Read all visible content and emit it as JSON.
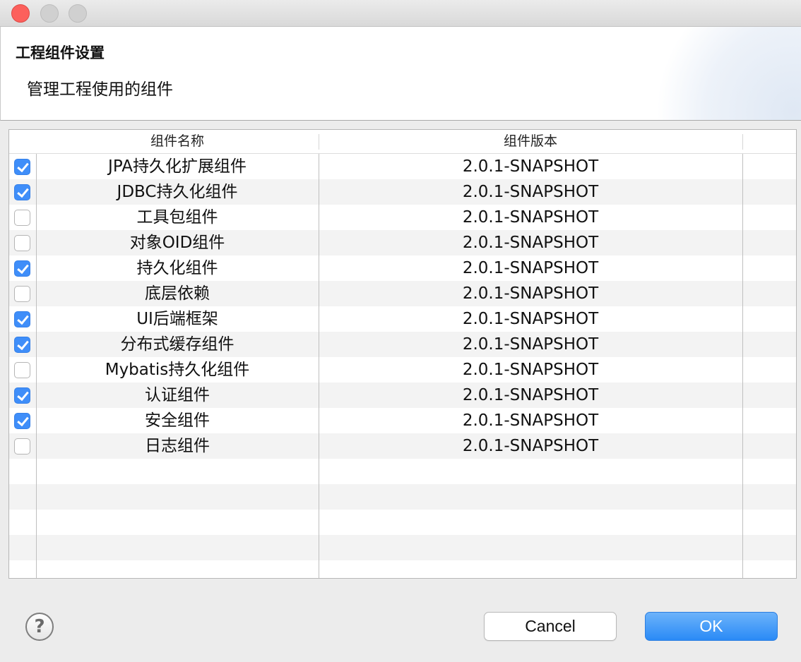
{
  "window": {
    "header_title": "工程组件设置",
    "header_description": "管理工程使用的组件"
  },
  "table": {
    "columns": [
      "组件名称",
      "组件版本"
    ],
    "rows": [
      {
        "checked": true,
        "name": "JPA持久化扩展组件",
        "version": "2.0.1-SNAPSHOT"
      },
      {
        "checked": true,
        "name": "JDBC持久化组件",
        "version": "2.0.1-SNAPSHOT"
      },
      {
        "checked": false,
        "name": "工具包组件",
        "version": "2.0.1-SNAPSHOT"
      },
      {
        "checked": false,
        "name": "对象OID组件",
        "version": "2.0.1-SNAPSHOT"
      },
      {
        "checked": true,
        "name": "持久化组件",
        "version": "2.0.1-SNAPSHOT"
      },
      {
        "checked": false,
        "name": "底层依赖",
        "version": "2.0.1-SNAPSHOT"
      },
      {
        "checked": true,
        "name": "UI后端框架",
        "version": "2.0.1-SNAPSHOT"
      },
      {
        "checked": true,
        "name": "分布式缓存组件",
        "version": "2.0.1-SNAPSHOT"
      },
      {
        "checked": false,
        "name": "Mybatis持久化组件",
        "version": "2.0.1-SNAPSHOT"
      },
      {
        "checked": true,
        "name": "认证组件",
        "version": "2.0.1-SNAPSHOT"
      },
      {
        "checked": true,
        "name": "安全组件",
        "version": "2.0.1-SNAPSHOT"
      },
      {
        "checked": false,
        "name": "日志组件",
        "version": "2.0.1-SNAPSHOT"
      }
    ],
    "empty_rows": 5
  },
  "footer": {
    "help_icon": "question-mark-icon",
    "help_glyph": "?",
    "cancel_label": "Cancel",
    "ok_label": "OK"
  },
  "colors": {
    "accent": "#3f8ef9",
    "close_light": "#fc605c"
  }
}
